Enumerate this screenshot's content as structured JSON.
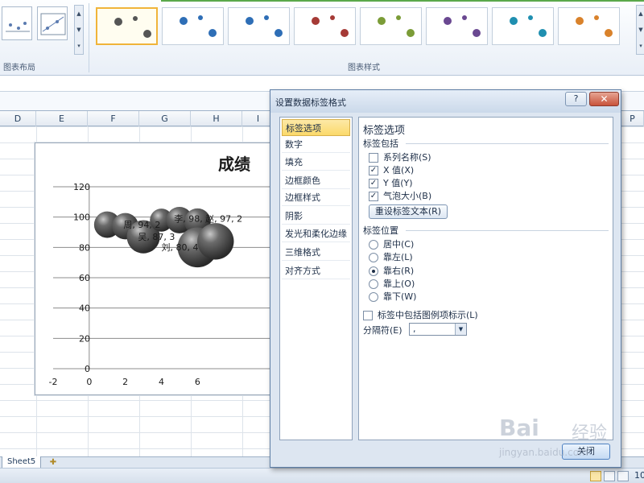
{
  "ribbon": {
    "layout_group_label": "图表布局",
    "styles_group_label": "图表样式",
    "style_colors": [
      "#555555",
      "#2e6eb6",
      "#2e6eb6",
      "#a53a36",
      "#7b9c37",
      "#6a4891",
      "#1f8fb0",
      "#d9822b"
    ]
  },
  "columns": [
    "D",
    "E",
    "F",
    "G",
    "H",
    "I",
    "P"
  ],
  "chart_data": {
    "type": "scatter",
    "title": "成绩",
    "xlim": [
      -2,
      12
    ],
    "ylim": [
      0,
      120
    ],
    "x_ticks": [
      "-2",
      "0",
      "2",
      "4",
      "6"
    ],
    "y_ticks": [
      "0",
      "20",
      "40",
      "60",
      "80",
      "100",
      "120"
    ],
    "grid": true,
    "points": [
      {
        "x": 1,
        "y": 95,
        "size": 2
      },
      {
        "x": 2,
        "y": 94,
        "size": 2
      },
      {
        "x": 3,
        "y": 87,
        "size": 3
      },
      {
        "x": 4,
        "y": 98,
        "size": 1.5
      },
      {
        "x": 5,
        "y": 98,
        "size": 2
      },
      {
        "x": 6,
        "y": 97,
        "size": 2
      },
      {
        "x": 6,
        "y": 80,
        "size": 4
      },
      {
        "x": 7,
        "y": 84,
        "size": 3.5
      }
    ],
    "data_labels": [
      "周, 94, 2",
      "吴, 87, 3",
      "李, 98, 赵, 97, 2",
      "刘, 80, 4"
    ]
  },
  "dialog": {
    "title": "设置数据标签格式",
    "help": "?",
    "close_x": "✕",
    "nav_items": [
      "标签选项",
      "数字",
      "填充",
      "边框颜色",
      "边框样式",
      "阴影",
      "发光和柔化边缘",
      "三维格式",
      "对齐方式"
    ],
    "heading": "标签选项",
    "contains_label": "标签包括",
    "checkboxes": [
      {
        "label": "系列名称(S)",
        "checked": false
      },
      {
        "label": "X 值(X)",
        "checked": true
      },
      {
        "label": "Y 值(Y)",
        "checked": true
      },
      {
        "label": "气泡大小(B)",
        "checked": true
      }
    ],
    "reset_button": "重设标签文本(R)",
    "position_label": "标签位置",
    "radios": [
      {
        "label": "居中(C)",
        "selected": false
      },
      {
        "label": "靠左(L)",
        "selected": false
      },
      {
        "label": "靠右(R)",
        "selected": true
      },
      {
        "label": "靠上(O)",
        "selected": false
      },
      {
        "label": "靠下(W)",
        "selected": false
      }
    ],
    "legend_key_label": "标签中包括图例项标示(L)",
    "separator_label": "分隔符(E)",
    "separator_value": ",",
    "close_button": "关闭"
  },
  "sheet_tab": "Sheet5",
  "zoom_level": "10",
  "watermark": {
    "brand": "Bai",
    "cn": "经验",
    "url": "jingyan.baidu.com"
  }
}
